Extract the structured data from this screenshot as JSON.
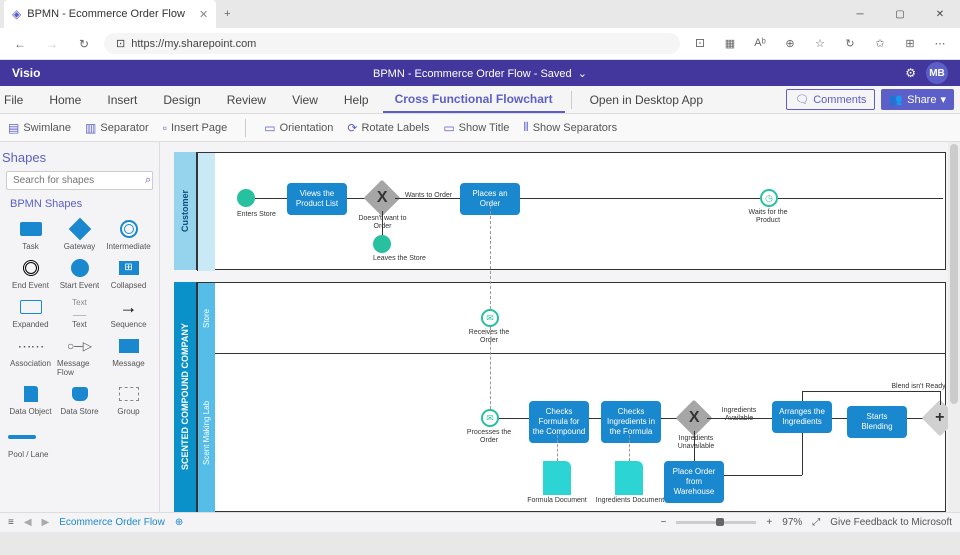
{
  "browser": {
    "tab_title": "BPMN - Ecommerce Order Flow",
    "url": "https://my.sharepoint.com"
  },
  "app": {
    "name": "Visio",
    "doc_title": "BPMN - Ecommerce Order Flow  -  Saved",
    "avatar": "MB"
  },
  "ribbon": {
    "tabs": [
      "File",
      "Home",
      "Insert",
      "Design",
      "Review",
      "View",
      "Help"
    ],
    "ctx_tab": "Cross Functional Flowchart",
    "open_desktop": "Open in Desktop App",
    "comments": "Comments",
    "share": "Share"
  },
  "toolbar": {
    "items": [
      "Swimlane",
      "Separator",
      "Insert Page",
      "Orientation",
      "Rotate Labels",
      "Show Title",
      "Show Separators"
    ]
  },
  "shapes_panel": {
    "title": "Shapes",
    "search_ph": "Search for shapes",
    "group": "BPMN Shapes",
    "shapes": [
      "Task",
      "Gateway",
      "Intermediate",
      "End Event",
      "Start Event",
      "Collapsed",
      "Expanded",
      "Text",
      "Sequence",
      "Association",
      "Message Flow",
      "Message",
      "Data Object",
      "Data Store",
      "Group"
    ],
    "pool_lane": "Pool / Lane"
  },
  "diagram": {
    "pool1": {
      "name": "Customer",
      "lanes": []
    },
    "pool2": {
      "name": "SCENTED COMPOUND COMPANY",
      "lanes": [
        "Store",
        "Scent Making Lab"
      ]
    },
    "nodes": {
      "enters": "Enters Store",
      "views": "Views the Product List",
      "gate1": "X",
      "wants": "Wants to Order",
      "noorder": "Doesn't want to Order",
      "leaves": "Leaves the Store",
      "places": "Places an Order",
      "waits": "Waits for the Product",
      "receives": "Receives the Order",
      "processes": "Processes the Order",
      "checkform": "Checks Formula for the Compound",
      "checking": "Checks Ingredients in the Formula",
      "gate2": "X",
      "avail": "Ingredients Available",
      "unavail": "Ingredients Unavailable",
      "arranges": "Arranges the Ingredients",
      "blend": "Starts Blending",
      "notready": "Blend isn't Ready",
      "gate3": "+",
      "placewh": "Place Order from Warehouse",
      "formdoc": "Formula Document",
      "ingdoc": "Ingredients Document"
    }
  },
  "status": {
    "sheet": "Ecommerce Order Flow",
    "zoom": "97%",
    "feedback": "Give Feedback to Microsoft"
  }
}
